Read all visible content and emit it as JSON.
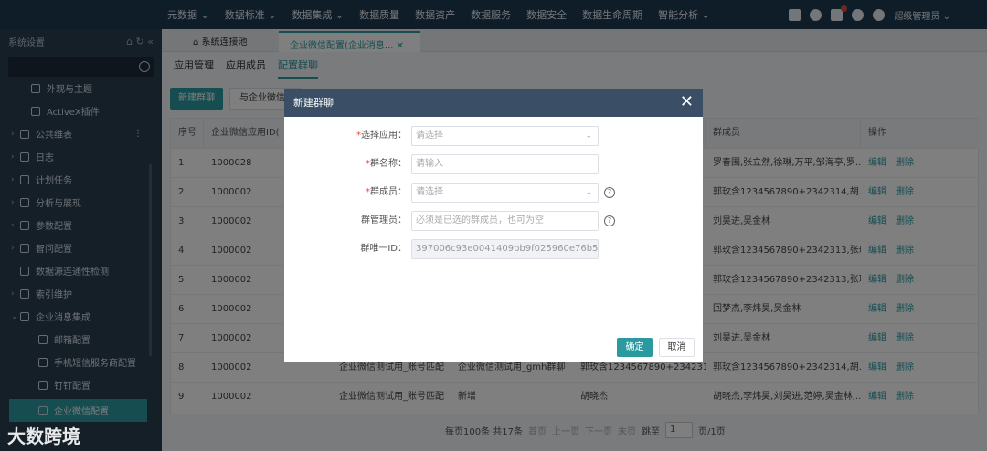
{
  "topnav": [
    "元数据 ⌄",
    "数据标准 ⌄",
    "数据集成 ⌄",
    "数据质量",
    "数据资产",
    "数据服务",
    "数据安全",
    "数据生命周期",
    "智能分析 ⌄"
  ],
  "user": "超级管理员 ⌄",
  "sidebar": {
    "title": "系统设置",
    "items": [
      {
        "arrow": "",
        "label": "外观与主题"
      },
      {
        "arrow": "",
        "label": "ActiveX插件"
      },
      {
        "arrow": "›",
        "label": "公共维表"
      },
      {
        "arrow": "›",
        "label": "日志"
      },
      {
        "arrow": "›",
        "label": "计划任务"
      },
      {
        "arrow": "›",
        "label": "分析与展现"
      },
      {
        "arrow": "›",
        "label": "参数配置"
      },
      {
        "arrow": "›",
        "label": "智问配置"
      },
      {
        "arrow": "",
        "label": "数据源连通性检测"
      },
      {
        "arrow": "›",
        "label": "索引维护"
      },
      {
        "arrow": "⌄",
        "label": "企业消息集成"
      },
      {
        "arrow": "",
        "label": "邮箱配置"
      },
      {
        "arrow": "",
        "label": "手机短信服务商配置"
      },
      {
        "arrow": "",
        "label": "钉钉配置"
      },
      {
        "arrow": "",
        "label": "企业微信配置"
      }
    ]
  },
  "tabs": {
    "home": "系统连接池",
    "current": "企业微信配置(企业消息...",
    "close": "✕"
  },
  "subtabs": [
    "应用管理",
    "应用成员",
    "配置群聊"
  ],
  "toolbar": {
    "new": "新建群聊",
    "sync": "与企业微信"
  },
  "table": {
    "headers": [
      "序号",
      "企业微信应用ID(",
      "",
      "",
      "",
      "群成员",
      "操作"
    ],
    "rows": [
      [
        "1",
        "1000028",
        "",
        "",
        "",
        "罗春围,张立然,徐琳,万平,邹海亭,罗..."
      ],
      [
        "2",
        "1000002",
        "",
        "",
        "",
        "郭玫含1234567890+2342314,胡..."
      ],
      [
        "3",
        "1000002",
        "",
        "",
        "",
        "刘昊进,吴金林"
      ],
      [
        "4",
        "1000002",
        "",
        "",
        "",
        "郭玫含1234567890+2342313,张瑶"
      ],
      [
        "5",
        "1000002",
        "",
        "",
        "",
        "郭玫含1234567890+2342313,张瑶"
      ],
      [
        "6",
        "1000002",
        "",
        "",
        "",
        "回梦杰,李炜昊,吴金林"
      ],
      [
        "7",
        "1000002",
        "",
        "",
        "",
        "刘昊进,吴金林"
      ],
      [
        "8",
        "1000002",
        "企业微信测试用_账号匹配",
        "企业微信测试用_gmh群聊",
        "郭玫含1234567890+2342314",
        "郭玫含1234567890+2342314,胡..."
      ],
      [
        "9",
        "1000002",
        "企业微信测试用_账号匹配",
        "新增",
        "胡晓杰",
        "胡晓杰,李炜昊,刘昊进,范婷,吴金林,..."
      ]
    ],
    "ops": {
      "edit": "编辑",
      "delete": "删除"
    }
  },
  "pager": {
    "info": "每页100条 共17条",
    "first": "首页",
    "prev": "上一页",
    "next": "下一页",
    "last": "末页",
    "goto": "跳至",
    "page": "1",
    "total": "页/1页"
  },
  "modal": {
    "title": "新建群聊",
    "close": "✕",
    "fields": [
      {
        "required": "*",
        "label": "选择应用：",
        "value": "请选择",
        "chev": "⌄",
        "help": ""
      },
      {
        "required": "*",
        "label": "群名称：",
        "value": "请输入",
        "chev": "",
        "help": ""
      },
      {
        "required": "*",
        "label": "群成员：",
        "value": "请选择",
        "chev": "⌄",
        "help": "?"
      },
      {
        "required": "",
        "label": "群管理员：",
        "value": "必须是已选的群成员，也可为空",
        "chev": "",
        "help": "?"
      },
      {
        "required": "",
        "label": "群唯一ID：",
        "value": "397006c93e0041409bb9f025960e76b5",
        "chev": "",
        "help": ""
      }
    ],
    "ok": "确定",
    "cancel": "取消"
  },
  "watermark": "大数跨境"
}
